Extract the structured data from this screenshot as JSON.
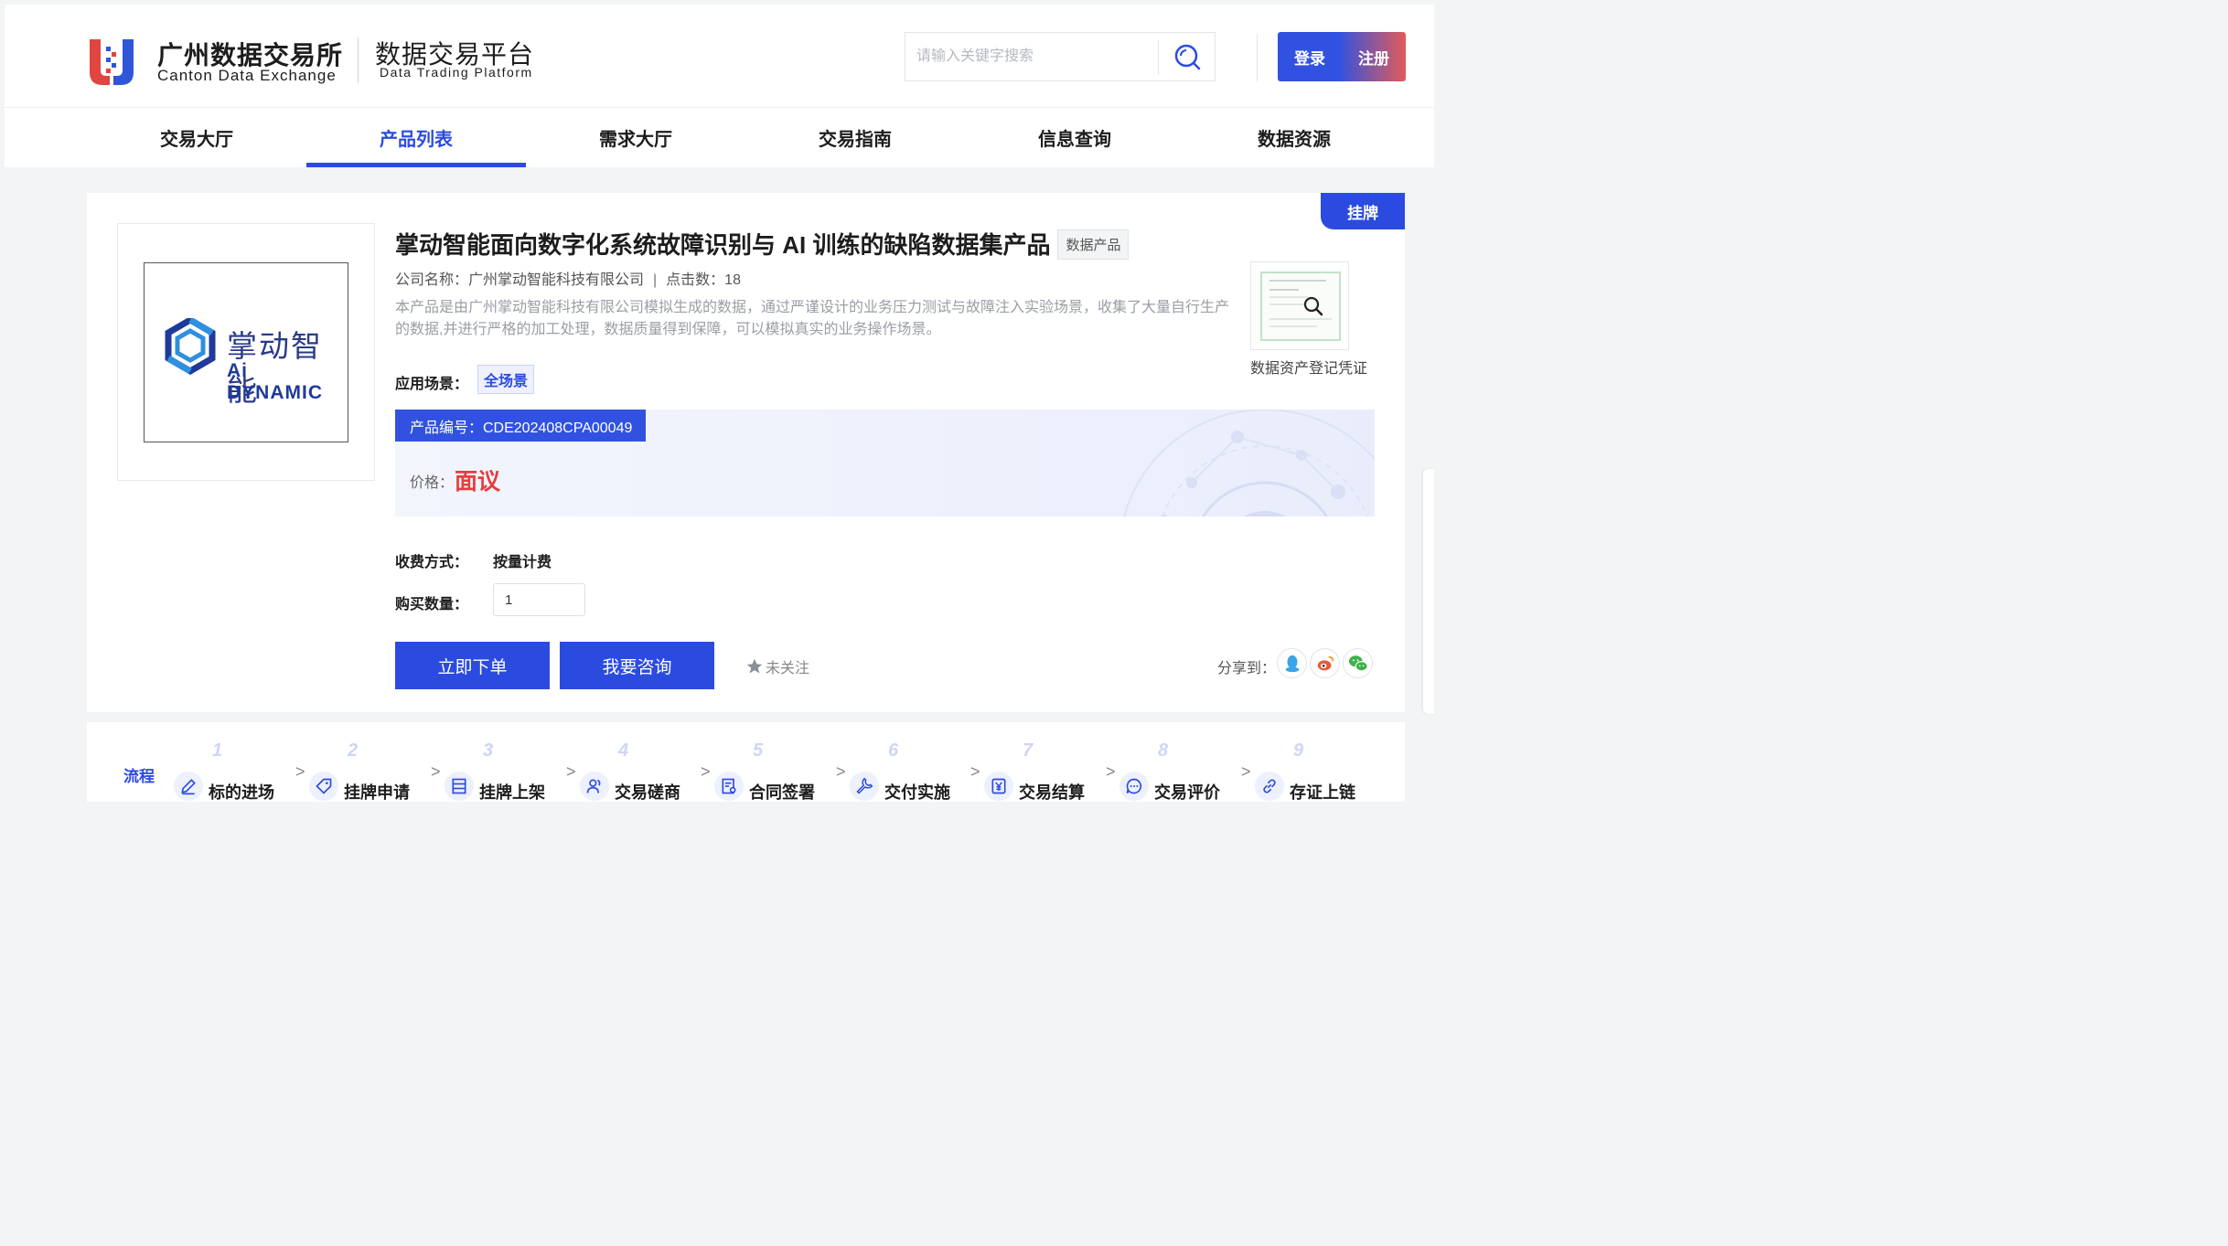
{
  "header": {
    "brand_cn": "广州数据交易所",
    "brand_en": "Canton Data Exchange",
    "platform_cn": "数据交易平台",
    "platform_en": "Data Trading Platform",
    "search_placeholder": "请输入关键字搜索",
    "login_label": "登录",
    "register_label": "注册"
  },
  "nav": {
    "items": [
      "交易大厅",
      "产品列表",
      "需求大厅",
      "交易指南",
      "信息查询",
      "数据资源"
    ],
    "active_index": 1
  },
  "product": {
    "listed_tag": "挂牌",
    "logo_cn": "掌动智能",
    "logo_en": "Ai DYNAMIC",
    "title": "掌动智能面向数字化系统故障识别与 AI 训练的缺陷数据集产品",
    "type_badge": "数据产品",
    "company": "公司名称：广州掌动智能科技有限公司",
    "clicks": "点击数：18",
    "description": "本产品是由广州掌动智能科技有限公司模拟生成的数据，通过严谨设计的业务压力测试与故障注入实验场景，收集了大量自行生产的数据,并进行严格的加工处理，数据质量得到保障，可以模拟真实的业务操作场景。",
    "certificate_label": "数据资产登记凭证",
    "scene_label": "应用场景：",
    "scene_tag": "全场景",
    "code": "产品编号：CDE202408CPA00049",
    "price_label": "价格：",
    "price_value": "面议",
    "fee_label": "收费方式：",
    "fee_value": "按量计费",
    "qty_label": "购买数量：",
    "qty_value": "1",
    "order_button": "立即下单",
    "consult_button": "我要咨询",
    "follow_label": "未关注",
    "share_label": "分享到："
  },
  "flow": {
    "title": "流程",
    "steps": [
      {
        "num": "1",
        "label": "标的进场",
        "icon": "pen-icon"
      },
      {
        "num": "2",
        "label": "挂牌申请",
        "icon": "tag-icon"
      },
      {
        "num": "3",
        "label": "挂牌上架",
        "icon": "shelf-icon"
      },
      {
        "num": "4",
        "label": "交易磋商",
        "icon": "users-icon"
      },
      {
        "num": "5",
        "label": "合同签署",
        "icon": "contract-icon"
      },
      {
        "num": "6",
        "label": "交付实施",
        "icon": "wrench-icon"
      },
      {
        "num": "7",
        "label": "交易结算",
        "icon": "yen-icon"
      },
      {
        "num": "8",
        "label": "交易评价",
        "icon": "chat-icon"
      },
      {
        "num": "9",
        "label": "存证上链",
        "icon": "link-icon"
      }
    ]
  },
  "colors": {
    "primary": "#2b4be0",
    "price_red": "#e53e3e",
    "logo_red": "#e0463f",
    "logo_blue": "#2f56d8"
  }
}
